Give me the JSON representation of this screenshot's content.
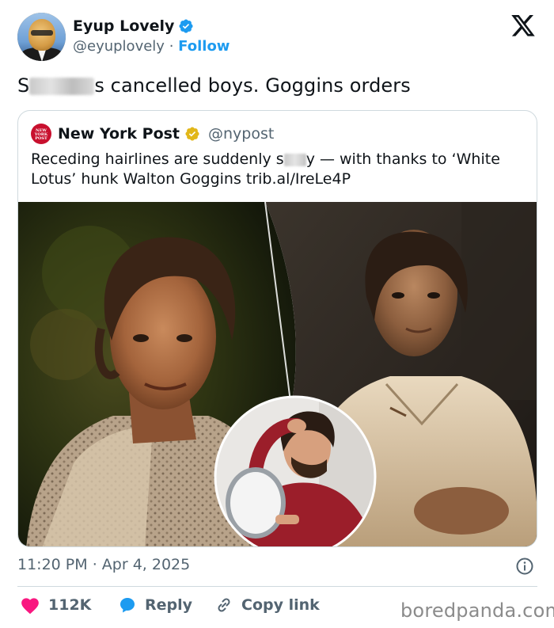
{
  "author": {
    "name": "Eyup Lovely",
    "handle": "@eyuplovely",
    "separator": "·",
    "follow_label": "Follow",
    "verified_icon": "verified-badge-icon"
  },
  "tweet": {
    "text_suffix": "s cancelled boys. Goggins orders",
    "text_prefix": "S"
  },
  "quote": {
    "source_name": "New York Post",
    "source_handle": "@nypost",
    "logo_text": [
      "NEW",
      "YORK",
      "POST"
    ],
    "text_before_blur": "Receding hairlines are suddenly s",
    "text_after_blur": "y — with thanks to ‘White Lotus’ hunk Walton Goggins trib.al/IreLe4P"
  },
  "meta": {
    "time": "11:20 PM",
    "separator": "·",
    "date": "Apr 4, 2025"
  },
  "actions": {
    "like_count": "112K",
    "reply_label": "Reply",
    "copy_label": "Copy link"
  },
  "watermark": "boredpanda.com",
  "colors": {
    "accent": "#1d9bf0",
    "like": "#f91880",
    "nypost_red": "#c8102e",
    "gold_badge": "#e2b719"
  }
}
